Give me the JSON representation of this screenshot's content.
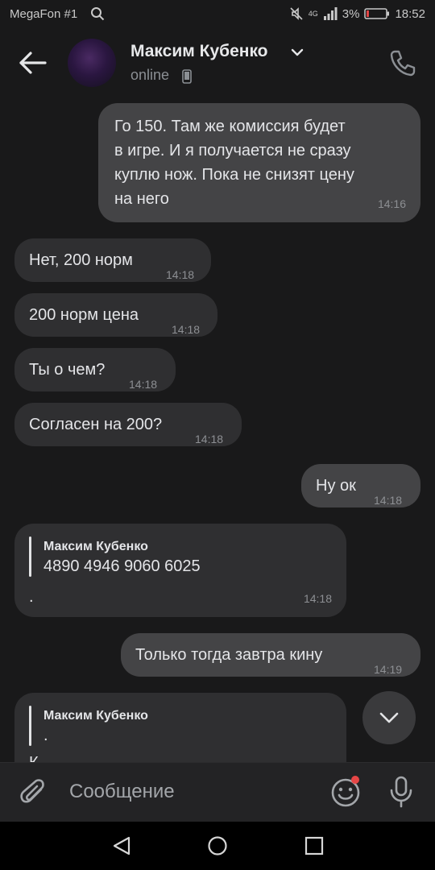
{
  "status_bar": {
    "carrier": "MegaFon #1",
    "network": "4G",
    "battery": "3%",
    "time": "18:52"
  },
  "header": {
    "contact_name": "Максим Кубенко",
    "status": "online"
  },
  "messages": [
    {
      "dir": "out",
      "lines": [
        "Го 150. Там же комиссия будет",
        "в игре. И я получается не сразу",
        "куплю нож. Пока не снизят цену",
        "на него"
      ],
      "time": "14:16"
    },
    {
      "dir": "in",
      "text": "Нет, 200 норм",
      "time": "14:18"
    },
    {
      "dir": "in",
      "text": "200 норм цена",
      "time": "14:18"
    },
    {
      "dir": "in",
      "text": "Ты о чем?",
      "time": "14:18"
    },
    {
      "dir": "in",
      "text": "Согласен на 200?",
      "time": "14:18"
    },
    {
      "dir": "out",
      "text": "Ну ок",
      "time": "14:18"
    },
    {
      "dir": "in",
      "reply_author": "Максим Кубенко",
      "reply_text": "4890 4946 9060 6025",
      "text": ".",
      "time": "14:18"
    },
    {
      "dir": "out",
      "text": "Только тогда завтра кину",
      "time": "14:19"
    },
    {
      "dir": "in",
      "reply_author": "Максим Кубенко",
      "reply_text": ".",
      "text": "К",
      "time": ""
    }
  ],
  "composer": {
    "placeholder": "Сообщение"
  },
  "colors": {
    "background": "#19191a",
    "incoming_bubble": "#2f2f31",
    "outgoing_bubble": "#444446",
    "unread_dot": "#e64646"
  },
  "icons": [
    "search-icon",
    "mute-icon",
    "signal-icon",
    "battery-icon",
    "back-arrow-icon",
    "chevron-down-icon",
    "mobile-device-icon",
    "phone-icon",
    "scroll-down-icon",
    "paperclip-icon",
    "emoji-icon",
    "microphone-icon",
    "nav-back-icon",
    "nav-home-icon",
    "nav-recents-icon"
  ]
}
